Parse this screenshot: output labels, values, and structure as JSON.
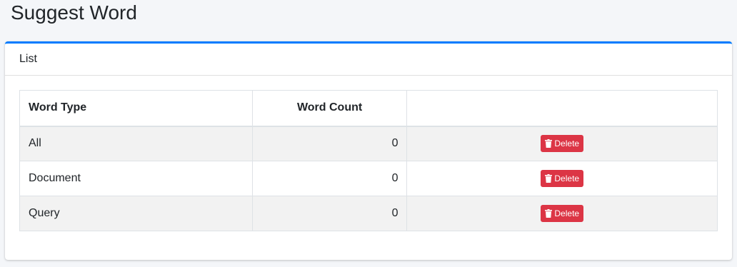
{
  "page": {
    "title": "Suggest Word"
  },
  "card": {
    "title": "List"
  },
  "table": {
    "headers": {
      "word_type": "Word Type",
      "word_count": "Word Count",
      "actions": ""
    },
    "rows": [
      {
        "word_type": "All",
        "word_count": "0",
        "delete_label": "Delete"
      },
      {
        "word_type": "Document",
        "word_count": "0",
        "delete_label": "Delete"
      },
      {
        "word_type": "Query",
        "word_count": "0",
        "delete_label": "Delete"
      }
    ]
  },
  "icons": {
    "delete": "trash-icon"
  },
  "colors": {
    "accent": "#007bff",
    "danger": "#dc3545",
    "background": "#f4f6f9"
  }
}
